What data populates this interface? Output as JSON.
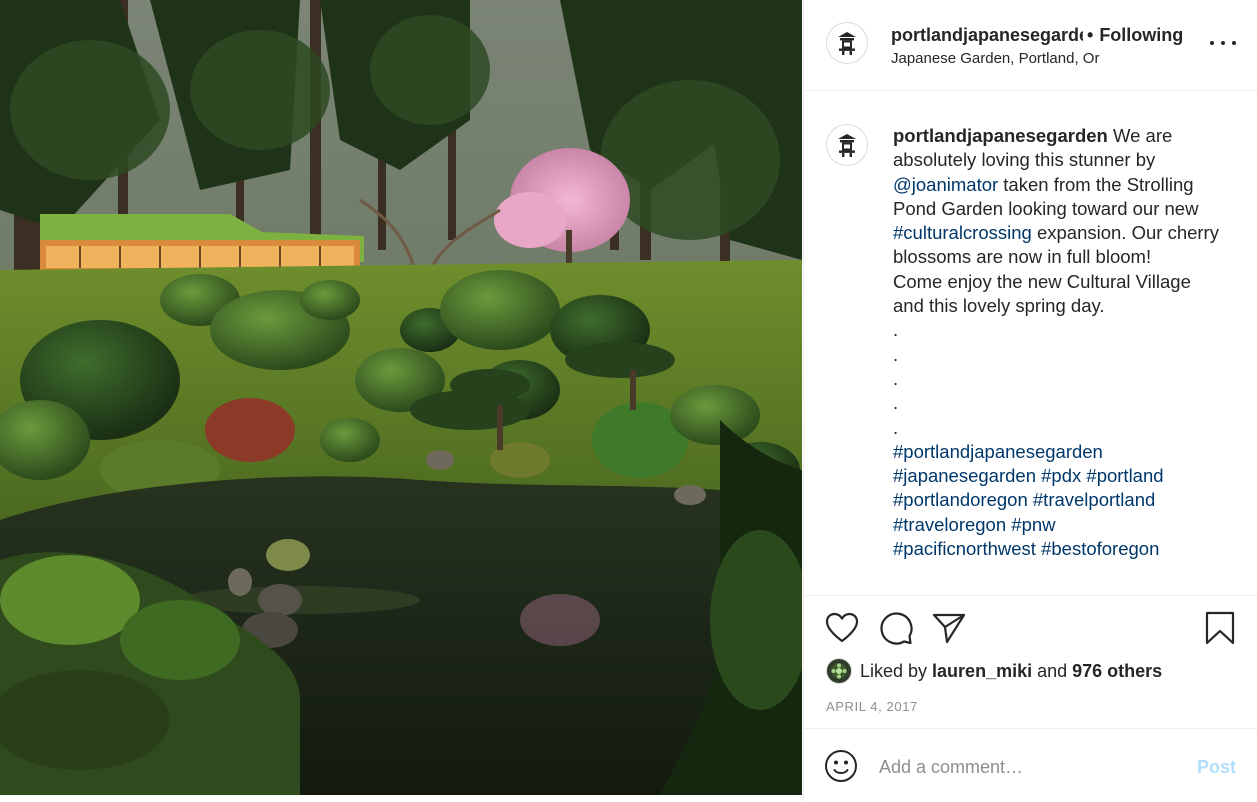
{
  "post": {
    "username": "portlandjapanesegarden",
    "username_truncated": "portlandjapanesegardе",
    "separator": "•",
    "follow_status": "Following",
    "location": "Japanese Garden, Portland, Or",
    "image_subject": "Japanese garden pond with pine trees, moss-roofed pavilion and pink cherry blossom tree"
  },
  "caption": {
    "username": "portlandjapanesegarden",
    "text_1": " We are absolutely loving this stunner by ",
    "mention": "@joanimator",
    "text_2": " taken from the Strolling Pond Garden looking toward our new ",
    "tag_1": "#culturalcrossing",
    "text_3": " expansion. Our cherry blossoms are now in full bloom!",
    "text_4": "Come enjoy the new Cultural Village and this lovely spring day.",
    "dots": [
      ".",
      ".",
      ".",
      ".",
      "."
    ],
    "hashtags": [
      "#portlandjapanesegarden",
      "#japanesegarden",
      "#pdx",
      "#portland",
      "#portlandoregon",
      "#travelportland",
      "#traveloregon",
      "#pnw",
      "#pacificnorthwest",
      "#bestoforegon"
    ]
  },
  "actions": {
    "icons": [
      "heart-icon",
      "comment-icon",
      "share-icon",
      "bookmark-icon"
    ]
  },
  "likes": {
    "prefix": "Liked by",
    "user": "lauren_miki",
    "and": "and",
    "others": "976 others"
  },
  "date": "APRIL 4, 2017",
  "comment_box": {
    "placeholder": "Add a comment…",
    "post_label": "Post"
  },
  "colors": {
    "link": "#00376b",
    "muted": "#8e8e8e",
    "post_disabled": "#b2dffc",
    "divider": "#efefef"
  }
}
